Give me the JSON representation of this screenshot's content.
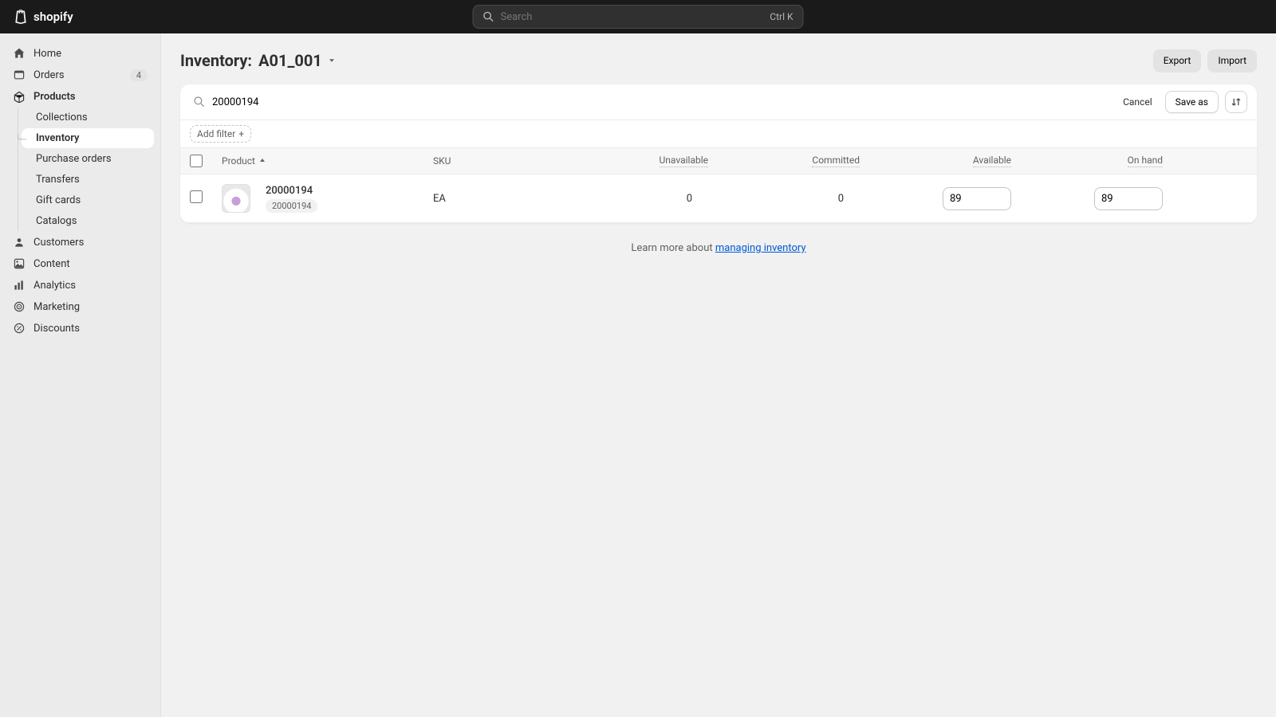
{
  "app_name": "shopify",
  "search": {
    "placeholder": "Search",
    "shortcut": "Ctrl K"
  },
  "sidebar": {
    "items": [
      {
        "label": "Home"
      },
      {
        "label": "Orders",
        "badge": "4"
      },
      {
        "label": "Products"
      },
      {
        "label": "Customers"
      },
      {
        "label": "Content"
      },
      {
        "label": "Analytics"
      },
      {
        "label": "Marketing"
      },
      {
        "label": "Discounts"
      }
    ],
    "products_sub": [
      {
        "label": "Collections"
      },
      {
        "label": "Inventory",
        "active": true
      },
      {
        "label": "Purchase orders"
      },
      {
        "label": "Transfers"
      },
      {
        "label": "Gift cards"
      },
      {
        "label": "Catalogs"
      }
    ]
  },
  "page": {
    "title_prefix": "Inventory:",
    "location": "A01_001",
    "export": "Export",
    "import": "Import"
  },
  "filter": {
    "query": "20000194",
    "cancel": "Cancel",
    "save_as": "Save as",
    "add_filter": "Add filter"
  },
  "table": {
    "headers": {
      "product": "Product",
      "sku": "SKU",
      "unavailable": "Unavailable",
      "committed": "Committed",
      "available": "Available",
      "on_hand": "On hand"
    },
    "rows": [
      {
        "title": "20000194",
        "sku_badge": "20000194",
        "sku": "EA",
        "unavailable": "0",
        "committed": "0",
        "available": "89",
        "on_hand": "89"
      }
    ]
  },
  "footer": {
    "learn_prefix": "Learn more about ",
    "learn_link": "managing inventory"
  }
}
